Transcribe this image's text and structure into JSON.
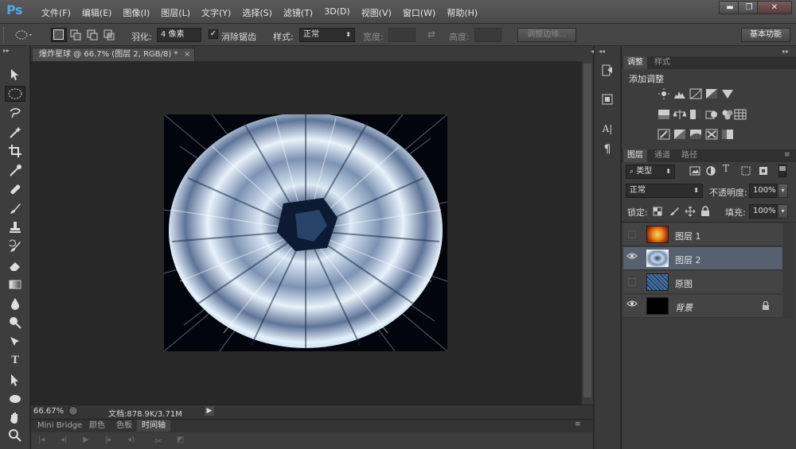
{
  "app": {
    "logo": "Ps",
    "menus": [
      "文件(F)",
      "编辑(E)",
      "图像(I)",
      "图层(L)",
      "文字(Y)",
      "选择(S)",
      "滤镜(T)",
      "3D(D)",
      "视图(V)",
      "窗口(W)",
      "帮助(H)"
    ],
    "window_controls": {
      "minimize": "▬",
      "restore": "❐",
      "close": "✕"
    }
  },
  "options": {
    "feather_label": "羽化:",
    "feather_value": "4 像素",
    "antialias_label": "消除锯齿",
    "style_label": "样式:",
    "style_value": "正常",
    "width_label": "宽度:",
    "height_label": "高度:",
    "refine_edge": "调整边缘...",
    "workspace": "基本功能"
  },
  "document": {
    "tab_title": "爆炸星球 @ 66.7% (图层 2, RGB/8) *",
    "tab_close": "×",
    "zoom": "66.67%",
    "doc_info": "文档:878.9K/3.71M"
  },
  "bottom_tabs": [
    "Mini Bridge",
    "颜色",
    "色板",
    "时间轴"
  ],
  "bottom_active": "时间轴",
  "adjustments": {
    "tabs": [
      "调整",
      "样式"
    ],
    "title": "添加调整"
  },
  "layers_panel": {
    "tabs": [
      "图层",
      "通道",
      "路径"
    ],
    "filter_kind": "类型",
    "blend_mode": "正常",
    "opacity_label": "不透明度:",
    "opacity_value": "100%",
    "lock_label": "锁定:",
    "fill_label": "填充:",
    "fill_value": "100%",
    "layers": [
      {
        "name": "图层 1",
        "visible": false,
        "selected": false
      },
      {
        "name": "图层 2",
        "visible": true,
        "selected": true
      },
      {
        "name": "原图",
        "visible": false,
        "selected": false
      },
      {
        "name": "背景",
        "visible": true,
        "selected": false,
        "locked": true
      }
    ]
  },
  "colors": {
    "accent": "#4fa9e8",
    "selected_layer": "#56606f",
    "canvas_bg": "#282828"
  }
}
